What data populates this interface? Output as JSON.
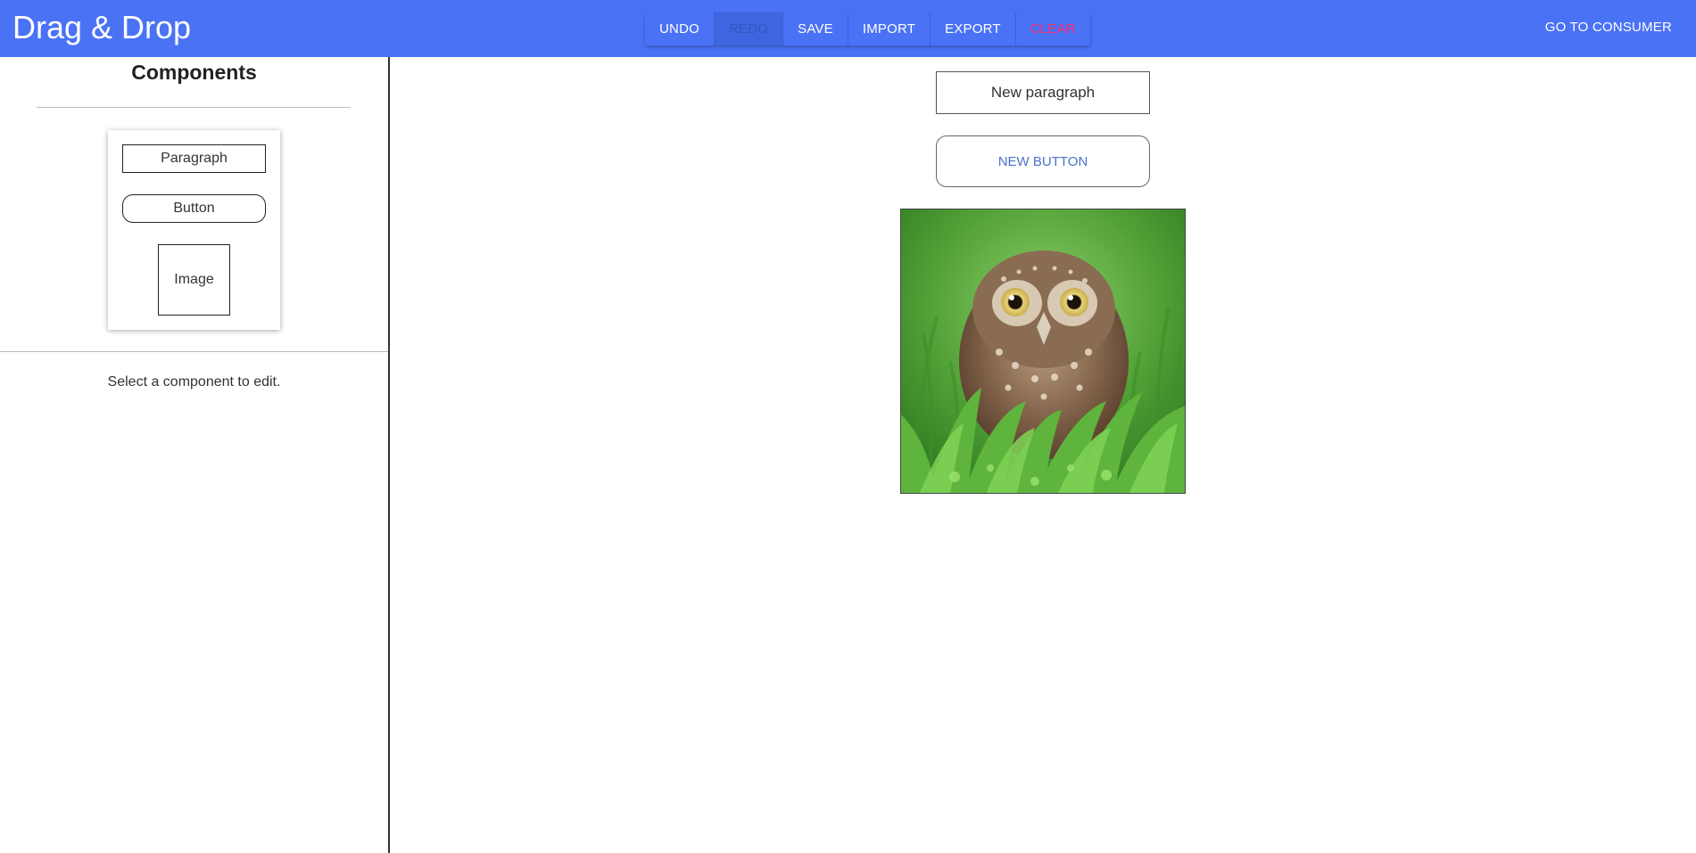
{
  "app": {
    "title": "Drag & Drop"
  },
  "toolbar": {
    "undo": "UNDO",
    "redo": "REDO",
    "save": "SAVE",
    "import": "IMPORT",
    "export": "EXPORT",
    "clear": "CLEAR"
  },
  "header": {
    "consumer_link": "GO TO CONSUMER"
  },
  "sidebar": {
    "title": "Components",
    "palette": {
      "paragraph": "Paragraph",
      "button": "Button",
      "image": "Image"
    },
    "edit_hint": "Select a component to edit."
  },
  "canvas": {
    "paragraph_text": "New paragraph",
    "button_text": "NEW BUTTON",
    "image_alt": "owl-in-grass-image"
  },
  "colors": {
    "header_bg": "#4a72f5",
    "clear_text": "#ff2a6a",
    "button_text": "#4a72c8"
  }
}
